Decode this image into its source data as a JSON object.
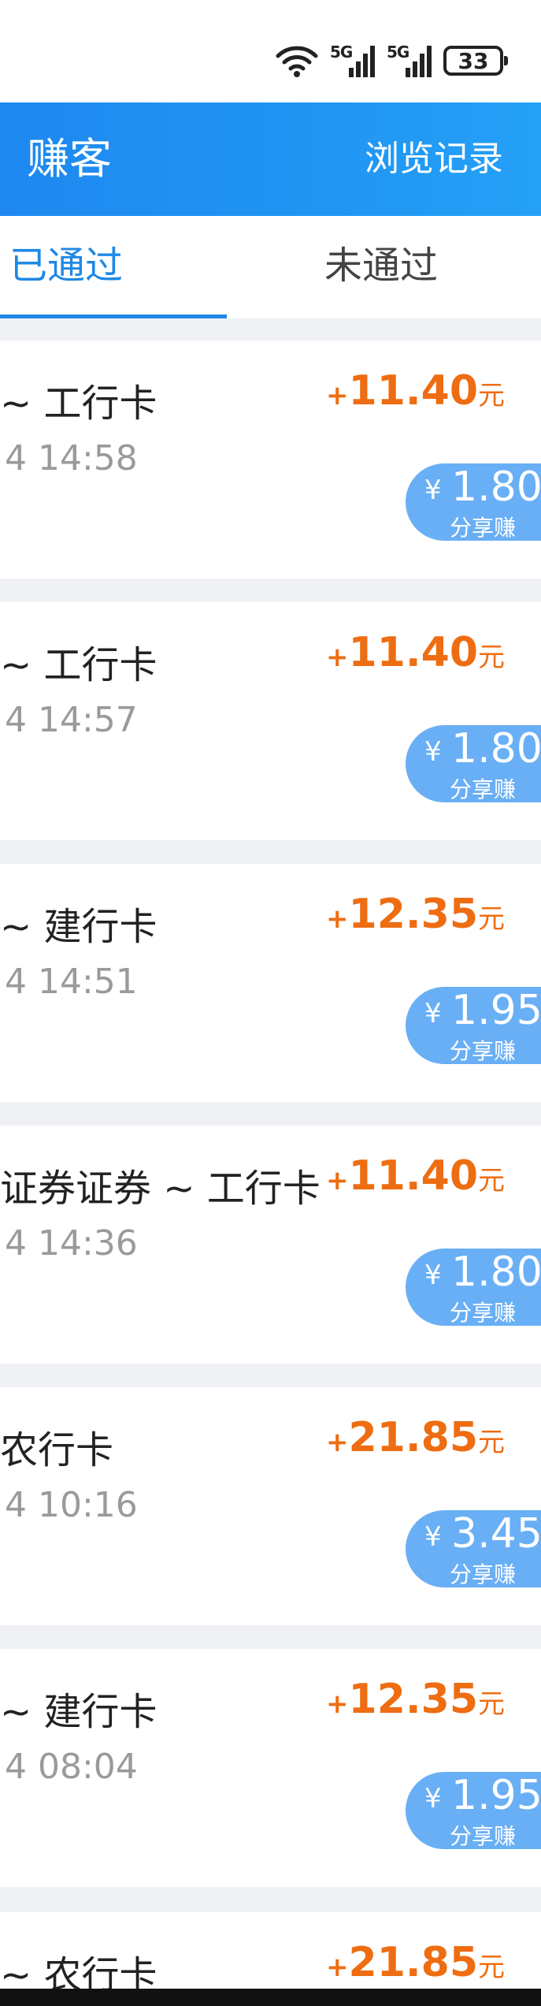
{
  "status_bar": {
    "network_1": "5G",
    "network_2": "5G",
    "battery": "33"
  },
  "header": {
    "title": "赚客",
    "history_label": "浏览记录"
  },
  "tabs": [
    {
      "label": "已通过",
      "active": true
    },
    {
      "label": "未通过",
      "active": false
    }
  ],
  "colors": {
    "accent": "#1e88e5",
    "amount": "#ee6d12",
    "share_pill": "#69aff5"
  },
  "records": [
    {
      "name": "~ 工行卡",
      "time": "4 14:58",
      "amount_sign": "+",
      "amount": "11.40",
      "unit": "元",
      "share_yen": "¥",
      "share_value": "1.80",
      "share_label": "分享赚"
    },
    {
      "name": "~ 工行卡",
      "time": "4 14:57",
      "amount_sign": "+",
      "amount": "11.40",
      "unit": "元",
      "share_yen": "¥",
      "share_value": "1.80",
      "share_label": "分享赚"
    },
    {
      "name": "~ 建行卡",
      "time": "4 14:51",
      "amount_sign": "+",
      "amount": "12.35",
      "unit": "元",
      "share_yen": "¥",
      "share_value": "1.95",
      "share_label": "分享赚"
    },
    {
      "name": "证券证券 ~ 工行卡",
      "time": "4 14:36",
      "amount_sign": "+",
      "amount": "11.40",
      "unit": "元",
      "share_yen": "¥",
      "share_value": "1.80",
      "share_label": "分享赚"
    },
    {
      "name": "农行卡",
      "time": "4 10:16",
      "amount_sign": "+",
      "amount": "21.85",
      "unit": "元",
      "share_yen": "¥",
      "share_value": "3.45",
      "share_label": "分享赚"
    },
    {
      "name": "~ 建行卡",
      "time": "4 08:04",
      "amount_sign": "+",
      "amount": "12.35",
      "unit": "元",
      "share_yen": "¥",
      "share_value": "1.95",
      "share_label": "分享赚"
    },
    {
      "name": "~ 农行卡",
      "time": "",
      "amount_sign": "+",
      "amount": "21.85",
      "unit": "元",
      "share_yen": "",
      "share_value": "",
      "share_label": ""
    }
  ]
}
